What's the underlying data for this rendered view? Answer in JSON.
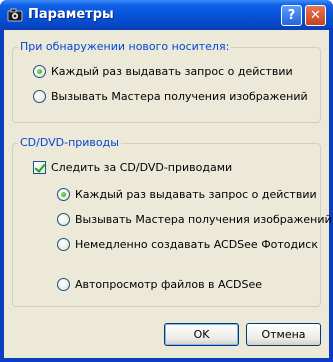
{
  "window": {
    "title": "Параметры",
    "help_label": "?",
    "close_label": "✕"
  },
  "group1": {
    "title": "При обнаружении нового носителя:",
    "options": [
      {
        "label": "Каждый раз выдавать запрос о действии",
        "selected": true
      },
      {
        "label": "Вызывать Мастера получения изображений",
        "selected": false
      }
    ]
  },
  "group2": {
    "title": "CD/DVD-приводы",
    "monitor_label": "Следить за CD/DVD-приводами",
    "monitor_checked": true,
    "options": [
      {
        "label": "Каждый раз выдавать запрос о действии",
        "selected": true
      },
      {
        "label": "Вызывать Мастера получения изображений",
        "selected": false
      },
      {
        "label": "Немедленно создавать ACDSee Фотодиск",
        "selected": false
      },
      {
        "label": "Автопросмотр файлов в ACDSee",
        "selected": false
      }
    ]
  },
  "buttons": {
    "ok": "OK",
    "cancel": "Отмена"
  }
}
